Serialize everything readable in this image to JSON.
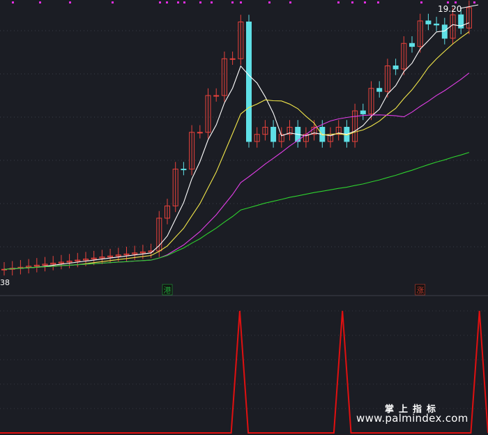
{
  "chart_data": [
    {
      "type": "candlestick",
      "annotations": {
        "max_price_label": "19.20",
        "min_price_label": "38"
      },
      "markers": [
        {
          "label": "港",
          "color": "#1fa83a",
          "x_index": 20
        },
        {
          "label": "涨",
          "color": "#c0392b",
          "x_index": 51
        }
      ],
      "top_dots_color": "#e22ee2",
      "colors": {
        "up": "#e8423c",
        "down": "#5fe0e6",
        "ma1": "#ffffff",
        "ma2": "#f1e64a",
        "ma3": "#e13ee6",
        "ma4": "#2ed12e"
      }
    },
    {
      "type": "line",
      "color": "#e01010",
      "values": [
        0,
        0,
        0,
        0,
        0,
        0,
        0,
        0,
        0,
        0,
        0,
        0,
        0,
        0,
        0,
        0,
        0,
        0,
        0,
        0,
        0,
        0,
        0,
        0,
        0,
        0,
        0,
        0,
        1,
        0,
        0,
        0,
        0,
        0,
        0,
        0,
        0,
        0,
        0,
        0,
        1,
        0,
        0,
        0,
        0,
        0,
        0,
        0,
        0,
        0,
        0,
        0,
        0,
        0,
        0,
        0,
        1,
        0
      ]
    }
  ],
  "watermark": {
    "line1": "掌上指标",
    "line2": "www.palmindex.com"
  }
}
